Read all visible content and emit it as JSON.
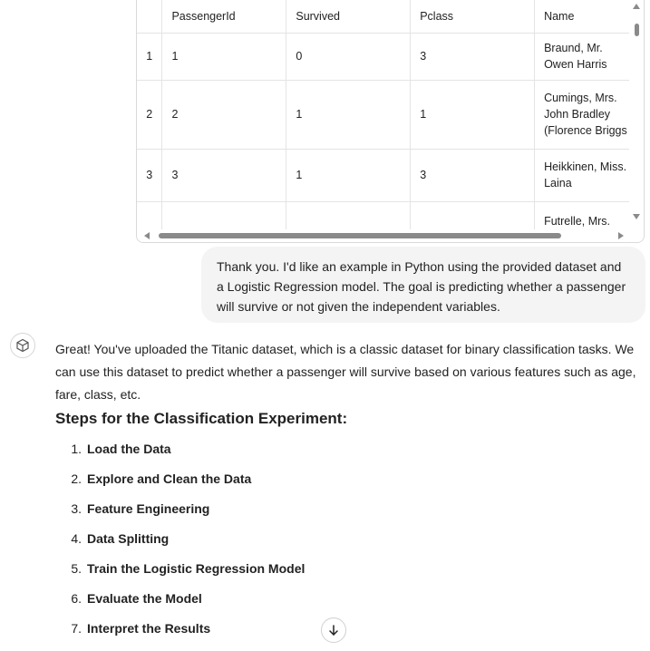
{
  "table": {
    "columns": [
      "",
      "PassengerId",
      "Survived",
      "Pclass",
      "Name"
    ],
    "rows": [
      {
        "index": "1",
        "PassengerId": "1",
        "Survived": "0",
        "Pclass": "3",
        "Name": "Braund, Mr. Owen Harris"
      },
      {
        "index": "2",
        "PassengerId": "2",
        "Survived": "1",
        "Pclass": "1",
        "Name": "Cumings, Mrs. John Bradley (Florence Briggs Thayer)"
      },
      {
        "index": "3",
        "PassengerId": "3",
        "Survived": "1",
        "Pclass": "3",
        "Name": "Heikkinen, Miss. Laina"
      },
      {
        "index": "",
        "PassengerId": "",
        "Survived": "",
        "Pclass": "",
        "Name": "Futrelle, Mrs."
      }
    ]
  },
  "user_message": "Thank you. I'd like an example in Python using the provided dataset and a Logistic Regression model. The goal is predicting whether a passenger will survive or not given the independent variables.",
  "assistant": {
    "intro": "Great! You've uploaded the Titanic dataset, which is a classic dataset for binary classification tasks. We can use this dataset to predict whether a passenger will survive based on various features such as age, fare, class, etc.",
    "steps_heading": "Steps for the Classification Experiment:",
    "steps": [
      {
        "num": "1.",
        "label": "Load the Data"
      },
      {
        "num": "2.",
        "label": "Explore and Clean the Data"
      },
      {
        "num": "3.",
        "label": "Feature Engineering"
      },
      {
        "num": "4.",
        "label": "Data Splitting"
      },
      {
        "num": "5.",
        "label": "Train the Logistic Regression Model"
      },
      {
        "num": "6.",
        "label": "Evaluate the Model"
      },
      {
        "num": "7.",
        "label": "Interpret the Results"
      }
    ]
  },
  "icons": {
    "avatar": "assistant-cube-icon",
    "scroll": "arrow-down-icon"
  }
}
